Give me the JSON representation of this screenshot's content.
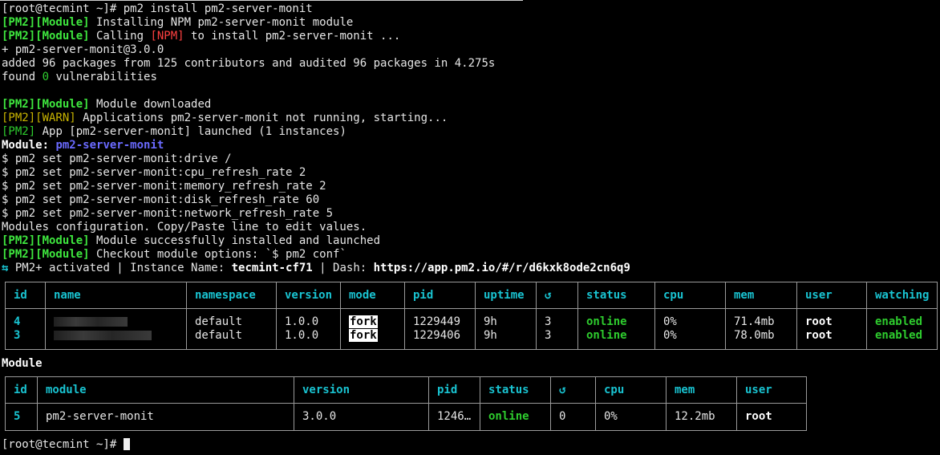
{
  "terminal": {
    "lines": [
      {
        "parts": [
          {
            "t": "[root@tecmint ~]# pm2 install pm2-server-monit",
            "c": ""
          }
        ]
      },
      {
        "parts": [
          {
            "t": "[PM2][Module]",
            "c": "g"
          },
          {
            "t": " Installing NPM pm2-server-monit module",
            "c": ""
          }
        ]
      },
      {
        "parts": [
          {
            "t": "[PM2][Module]",
            "c": "g"
          },
          {
            "t": " Calling ",
            "c": ""
          },
          {
            "t": "[NPM]",
            "c": "r"
          },
          {
            "t": " to install pm2-server-monit ...",
            "c": ""
          }
        ]
      },
      {
        "parts": [
          {
            "t": "+ pm2-server-monit@3.0.0",
            "c": ""
          }
        ]
      },
      {
        "parts": [
          {
            "t": "added 96 packages from 125 contributors and audited 96 packages in 4.275s",
            "c": ""
          }
        ]
      },
      {
        "parts": [
          {
            "t": "found ",
            "c": ""
          },
          {
            "t": "0",
            "c": "gr"
          },
          {
            "t": " vulnerabilities",
            "c": ""
          }
        ]
      },
      {
        "parts": [
          {
            "t": " ",
            "c": ""
          }
        ]
      },
      {
        "parts": [
          {
            "t": "[PM2][Module]",
            "c": "g"
          },
          {
            "t": " Module downloaded",
            "c": ""
          }
        ]
      },
      {
        "parts": [
          {
            "t": "[PM2][WARN]",
            "c": "y"
          },
          {
            "t": " Applications pm2-server-monit not running, starting...",
            "c": ""
          }
        ]
      },
      {
        "parts": [
          {
            "t": "[PM2]",
            "c": "gr"
          },
          {
            "t": " App [pm2-server-monit] launched (1 instances)",
            "c": ""
          }
        ]
      },
      {
        "parts": [
          {
            "t": "Module: ",
            "c": "b"
          },
          {
            "t": "pm2-server-monit",
            "c": "blue"
          }
        ]
      },
      {
        "parts": [
          {
            "t": "$ pm2 set pm2-server-monit:drive /",
            "c": ""
          }
        ]
      },
      {
        "parts": [
          {
            "t": "$ pm2 set pm2-server-monit:cpu_refresh_rate 2",
            "c": ""
          }
        ]
      },
      {
        "parts": [
          {
            "t": "$ pm2 set pm2-server-monit:memory_refresh_rate 2",
            "c": ""
          }
        ]
      },
      {
        "parts": [
          {
            "t": "$ pm2 set pm2-server-monit:disk_refresh_rate 60",
            "c": ""
          }
        ]
      },
      {
        "parts": [
          {
            "t": "$ pm2 set pm2-server-monit:network_refresh_rate 5",
            "c": ""
          }
        ]
      },
      {
        "parts": [
          {
            "t": "Modules configuration. Copy/Paste line to edit values.",
            "c": ""
          }
        ]
      },
      {
        "parts": [
          {
            "t": "[PM2][Module]",
            "c": "g"
          },
          {
            "t": " Module successfully installed and launched",
            "c": ""
          }
        ]
      },
      {
        "parts": [
          {
            "t": "[PM2][Module]",
            "c": "g"
          },
          {
            "t": " Checkout module options: `$ pm2 conf`",
            "c": ""
          }
        ]
      },
      {
        "parts": [
          {
            "t": "⇆",
            "c": "cyan"
          },
          {
            "t": " PM2+ activated | Instance Name: ",
            "c": ""
          },
          {
            "t": "tecmint-cf71",
            "c": "b"
          },
          {
            "t": " | Dash: ",
            "c": ""
          },
          {
            "t": "https://app.pm2.io/#/r/d6kxk8ode2cn6q9",
            "c": "b"
          }
        ]
      }
    ]
  },
  "process_table": {
    "headers": [
      "id",
      "name",
      "namespace",
      "version",
      "mode",
      "pid",
      "uptime",
      "↺",
      "status",
      "cpu",
      "mem",
      "user",
      "watching"
    ],
    "rows": [
      {
        "id": "4",
        "namespace": "default",
        "version": "1.0.0",
        "mode": "fork",
        "pid": "1229449",
        "uptime": "9h",
        "restarts": "3",
        "status": "online",
        "cpu": "0%",
        "mem": "71.4mb",
        "user": "root",
        "watching": "enabled"
      },
      {
        "id": "3",
        "namespace": "default",
        "version": "1.0.0",
        "mode": "fork",
        "pid": "1229406",
        "uptime": "9h",
        "restarts": "3",
        "status": "online",
        "cpu": "0%",
        "mem": "78.0mb",
        "user": "root",
        "watching": "enabled"
      }
    ]
  },
  "module_section": {
    "title": "Module",
    "headers": [
      "id",
      "module",
      "version",
      "pid",
      "status",
      "↺",
      "cpu",
      "mem",
      "user"
    ],
    "row": {
      "id": "5",
      "module": "pm2-server-monit",
      "version": "3.0.0",
      "pid": "1246…",
      "status": "online",
      "restarts": "0",
      "cpu": "0%",
      "mem": "12.2mb",
      "user": "root"
    }
  },
  "final_prompt": "[root@tecmint ~]# ",
  "colors": {
    "green": "#3ee63e",
    "yellow": "#c8b400",
    "red": "#ff4040",
    "cyan": "#19c3d1",
    "blue": "#6a6aff"
  }
}
